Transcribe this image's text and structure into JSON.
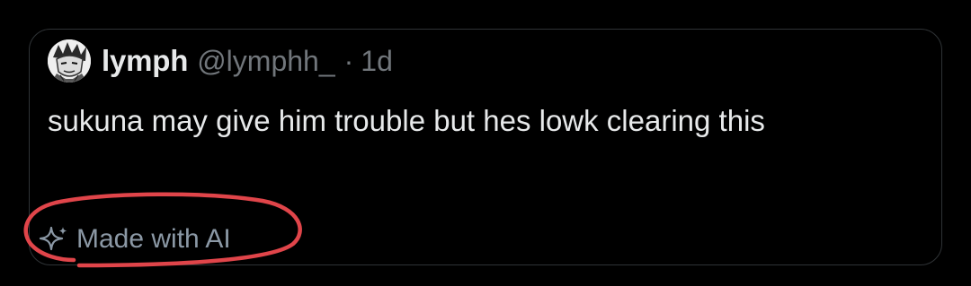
{
  "post": {
    "author": {
      "display_name": "lymph",
      "handle": "@lymphh_",
      "avatar": "avatar-manga-character"
    },
    "separator": "·",
    "timestamp": "1d",
    "text": "sukuna may give him trouble but hes lowk clearing this",
    "ai_label": {
      "icon": "sparkle-icon",
      "text": "Made with AI"
    }
  },
  "annotation": {
    "shape": "hand-drawn circle",
    "color": "#e0454a",
    "target": "ai_label"
  },
  "colors": {
    "background": "#000000",
    "border": "#2f3336",
    "primary_text": "#e7e9ea",
    "secondary_text": "#71767b",
    "ai_label_text": "#8b98a5",
    "annotation": "#e0454a"
  }
}
